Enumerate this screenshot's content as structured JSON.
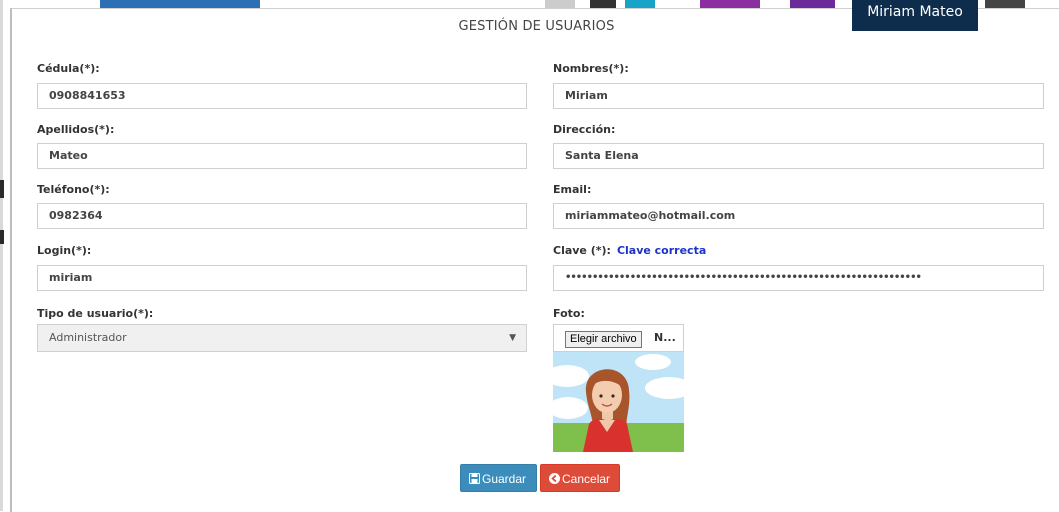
{
  "header": {
    "user_name": "Miriam Mateo"
  },
  "modal": {
    "title": "GESTIÓN DE USUARIOS"
  },
  "form": {
    "cedula": {
      "label": "Cédula(*):",
      "value": "0908841653"
    },
    "nombres": {
      "label": "Nombres(*):",
      "value": "Miriam"
    },
    "apellidos": {
      "label": "Apellidos(*):",
      "value": "Mateo"
    },
    "direccion": {
      "label": "Dirección:",
      "value": "Santa Elena"
    },
    "telefono": {
      "label": "Teléfono(*):",
      "value": "0982364"
    },
    "email": {
      "label": "Email:",
      "value": "miriammateo@hotmail.com"
    },
    "login": {
      "label": "Login(*):",
      "value": "miriam"
    },
    "clave": {
      "label": "Clave (*):",
      "status": "Clave correcta",
      "value": "••••••••••••••••••••••••••••••••••••••••••••••••••••••••••••••••••"
    },
    "tipo_usuario": {
      "label": "Tipo de usuario(*):",
      "selected": "Administrador"
    },
    "foto": {
      "label": "Foto:",
      "button": "Elegir archivo",
      "file_name": "N..."
    }
  },
  "actions": {
    "save": "Guardar",
    "cancel": "Cancelar"
  },
  "colors": {
    "primary": "#3c8dbc",
    "danger": "#dd4b39",
    "badge": "#0e2d4d",
    "link": "#1b33c7"
  },
  "icons": {
    "save": "floppy-disk-icon",
    "cancel": "circle-arrow-left-icon",
    "select": "caret-down-icon"
  }
}
